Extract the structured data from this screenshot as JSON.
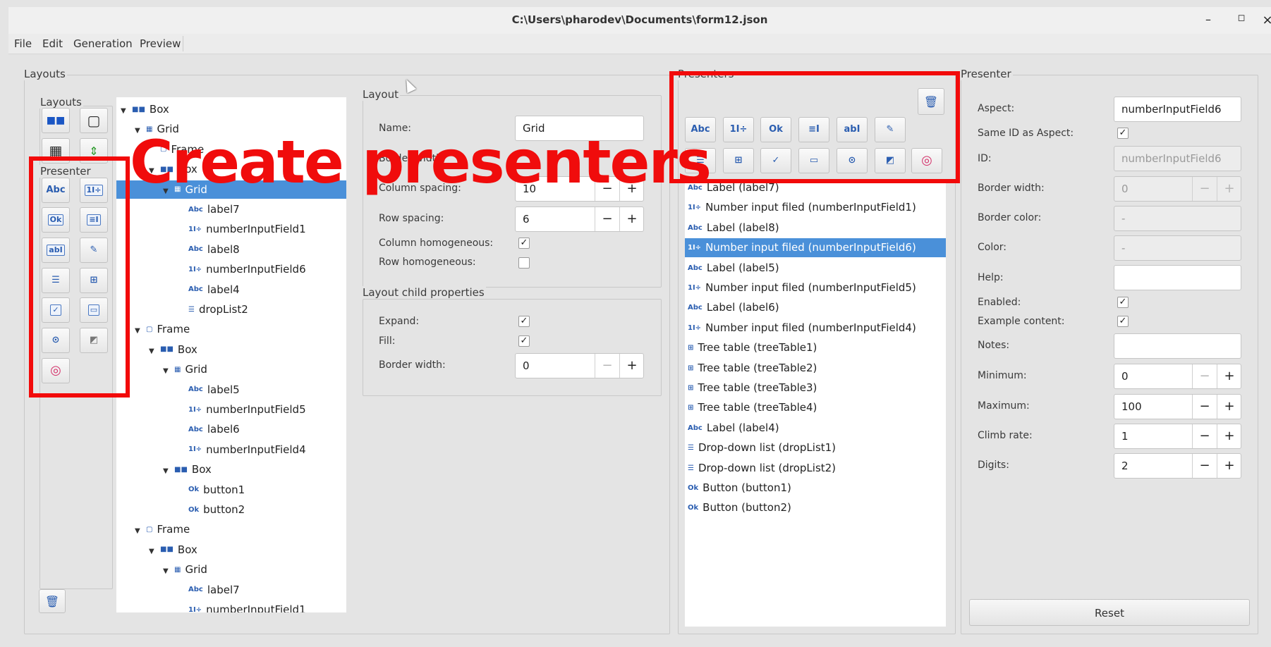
{
  "window": {
    "title": "C:\\Users\\pharodev\\Documents\\form12.json",
    "controls": [
      "–",
      "◻",
      "×"
    ]
  },
  "menu": [
    "File",
    "Edit",
    "Generation",
    "Preview"
  ],
  "groups": {
    "layouts_outer": "Layouts",
    "layouts_inner": "Layouts",
    "presenter_inner": "Presenter",
    "presenters": "Presenters",
    "presenter_props": "Presenter"
  },
  "palette": {
    "layouts_icons": [
      "box-icon",
      "frame-icon",
      "grid-icon",
      "paned-icon"
    ],
    "presenter_icons": [
      "label-icon",
      "number-input-icon",
      "button-icon",
      "text-area-icon",
      "text-input-icon",
      "text-editor-icon",
      "drop-down-icon",
      "tree-table-icon",
      "checkbox-icon",
      "progress-bar-icon",
      "radio-icon",
      "image-icon",
      "color-picker-icon"
    ],
    "presenter_glyphs": [
      "Abc",
      "1I÷",
      "Ok",
      "≡I",
      "abI",
      "✎",
      "☰",
      "⊞",
      "✓",
      "▭",
      "⊙",
      "◩",
      "◎"
    ]
  },
  "tree": [
    {
      "depth": 0,
      "arrow": "▼",
      "icon": "■■",
      "label": "Box"
    },
    {
      "depth": 1,
      "arrow": "▼",
      "icon": "▦",
      "label": "Grid"
    },
    {
      "depth": 2,
      "arrow": "",
      "icon": "▢",
      "label": "Frame"
    },
    {
      "depth": 2,
      "arrow": "▼",
      "icon": "■■",
      "label": "Box"
    },
    {
      "depth": 3,
      "arrow": "▼",
      "icon": "▦",
      "label": "Grid",
      "selected": true
    },
    {
      "depth": 4,
      "arrow": "",
      "icon": "Abc",
      "label": "label7"
    },
    {
      "depth": 4,
      "arrow": "",
      "icon": "1I÷",
      "label": "numberInputField1"
    },
    {
      "depth": 4,
      "arrow": "",
      "icon": "Abc",
      "label": "label8"
    },
    {
      "depth": 4,
      "arrow": "",
      "icon": "1I÷",
      "label": "numberInputField6"
    },
    {
      "depth": 4,
      "arrow": "",
      "icon": "Abc",
      "label": "label4"
    },
    {
      "depth": 4,
      "arrow": "",
      "icon": "☰",
      "label": "dropList2"
    },
    {
      "depth": 1,
      "arrow": "▼",
      "icon": "▢",
      "label": "Frame"
    },
    {
      "depth": 2,
      "arrow": "▼",
      "icon": "■■",
      "label": "Box"
    },
    {
      "depth": 3,
      "arrow": "▼",
      "icon": "▦",
      "label": "Grid"
    },
    {
      "depth": 4,
      "arrow": "",
      "icon": "Abc",
      "label": "label5"
    },
    {
      "depth": 4,
      "arrow": "",
      "icon": "1I÷",
      "label": "numberInputField5"
    },
    {
      "depth": 4,
      "arrow": "",
      "icon": "Abc",
      "label": "label6"
    },
    {
      "depth": 4,
      "arrow": "",
      "icon": "1I÷",
      "label": "numberInputField4"
    },
    {
      "depth": 3,
      "arrow": "▼",
      "icon": "■■",
      "label": "Box"
    },
    {
      "depth": 4,
      "arrow": "",
      "icon": "Ok",
      "label": "button1"
    },
    {
      "depth": 4,
      "arrow": "",
      "icon": "Ok",
      "label": "button2"
    },
    {
      "depth": 1,
      "arrow": "▼",
      "icon": "▢",
      "label": "Frame"
    },
    {
      "depth": 2,
      "arrow": "▼",
      "icon": "■■",
      "label": "Box"
    },
    {
      "depth": 3,
      "arrow": "▼",
      "icon": "▦",
      "label": "Grid"
    },
    {
      "depth": 4,
      "arrow": "",
      "icon": "Abc",
      "label": "label7"
    },
    {
      "depth": 4,
      "arrow": "",
      "icon": "1I÷",
      "label": "numberInputField1"
    }
  ],
  "layout_panel": {
    "group_label": "Layout",
    "name_label": "Name:",
    "name_value": "Grid",
    "border_width_label": "Border width:",
    "column_spacing_label": "Column spacing:",
    "column_spacing_value": "10",
    "row_spacing_label": "Row spacing:",
    "row_spacing_value": "6",
    "column_homogeneous_label": "Column homogeneous:",
    "column_homogeneous_checked": true,
    "row_homogeneous_label": "Row homogeneous:",
    "row_homogeneous_checked": false,
    "child_group_label": "Layout child properties",
    "expand_label": "Expand:",
    "fill_label": "Fill:",
    "child_border_width_label": "Border width:",
    "child_border_width_value": "0"
  },
  "presenters_list": [
    {
      "icon": "Abc",
      "label": "Label (label7)"
    },
    {
      "icon": "1I÷",
      "label": "Number input filed (numberInputField1)"
    },
    {
      "icon": "Abc",
      "label": "Label (label8)"
    },
    {
      "icon": "1I÷",
      "label": "Number input filed (numberInputField6)",
      "selected": true
    },
    {
      "icon": "Abc",
      "label": "Label (label5)"
    },
    {
      "icon": "1I÷",
      "label": "Number input filed (numberInputField5)"
    },
    {
      "icon": "Abc",
      "label": "Label (label6)"
    },
    {
      "icon": "1I÷",
      "label": "Number input filed (numberInputField4)"
    },
    {
      "icon": "⊞",
      "label": "Tree table (treeTable1)"
    },
    {
      "icon": "⊞",
      "label": "Tree table (treeTable2)"
    },
    {
      "icon": "⊞",
      "label": "Tree table (treeTable3)"
    },
    {
      "icon": "⊞",
      "label": "Tree table (treeTable4)"
    },
    {
      "icon": "Abc",
      "label": "Label (label4)"
    },
    {
      "icon": "☰",
      "label": "Drop-down list (dropList1)"
    },
    {
      "icon": "☰",
      "label": "Drop-down list (dropList2)"
    },
    {
      "icon": "Ok",
      "label": "Button (button1)"
    },
    {
      "icon": "Ok",
      "label": "Button (button2)"
    }
  ],
  "presenter_props": {
    "aspect_label": "Aspect:",
    "aspect_value": "numberInputField6",
    "same_id_label": "Same ID as Aspect:",
    "id_label": "ID:",
    "id_value": "numberInputField6",
    "border_width_label": "Border width:",
    "border_width_value": "0",
    "border_color_label": "Border color:",
    "border_color_value": "-",
    "color_label": "Color:",
    "color_value": "-",
    "help_label": "Help:",
    "enabled_label": "Enabled:",
    "example_label": "Example content:",
    "notes_label": "Notes:",
    "minimum_label": "Minimum:",
    "minimum_value": "0",
    "maximum_label": "Maximum:",
    "maximum_value": "100",
    "climb_label": "Climb rate:",
    "climb_value": "1",
    "digits_label": "Digits:",
    "digits_value": "2",
    "reset_label": "Reset"
  },
  "steppers": {
    "minus": "−",
    "plus": "+"
  },
  "overlay": {
    "text": "Create presenters",
    "color": "#f20a0a"
  },
  "colors": {
    "selection": "#4a90d9",
    "accent_icon": "#2a5db0"
  }
}
